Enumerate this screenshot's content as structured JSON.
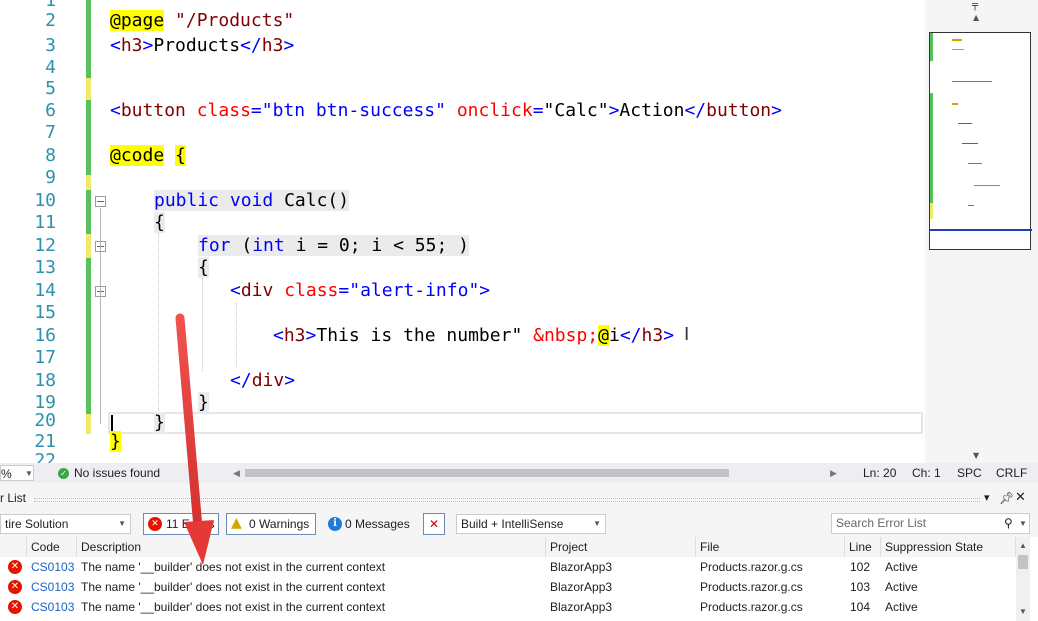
{
  "editor": {
    "lines": [
      {
        "num": "1"
      },
      {
        "num": "2"
      },
      {
        "num": "3"
      },
      {
        "num": "4"
      },
      {
        "num": "5"
      },
      {
        "num": "6"
      },
      {
        "num": "7"
      },
      {
        "num": "8"
      },
      {
        "num": "9"
      },
      {
        "num": "10"
      },
      {
        "num": "11"
      },
      {
        "num": "12"
      },
      {
        "num": "13"
      },
      {
        "num": "14"
      },
      {
        "num": "15"
      },
      {
        "num": "16"
      },
      {
        "num": "17"
      },
      {
        "num": "18"
      },
      {
        "num": "19"
      },
      {
        "num": "20"
      },
      {
        "num": "21"
      },
      {
        "num": "22"
      }
    ],
    "tokens": {
      "page_directive": "@page",
      "page_route": "\"/Products\"",
      "h3_open": "<h3>",
      "products_text": "Products",
      "h3_close": "</h3>",
      "button_open": "<button",
      "class_attr": "class=",
      "btn_classes": "\"btn btn-success\"",
      "onclick_attr": "onclick=",
      "onclick_val": "\"Calc\"",
      "gt": ">",
      "action_text": "Action",
      "button_close": "</button>",
      "lt": ">",
      "code_directive": "@code",
      "open_brace": "{",
      "close_brace": "}",
      "kw_public": "public",
      "kw_void": "void",
      "method_sig": "Calc()",
      "kw_for": "for",
      "paren_open": "(",
      "kw_int": "int",
      "for_rest": "i = 0; i < 55; )",
      "div_open": "<div",
      "div_class_val": "\"alert-info\"",
      "div_close": "</div>",
      "number_text": "This is the number\"",
      "nbsp": "&nbsp;",
      "at_sign": "@",
      "var_i": "i",
      "h3_close2": "</h3>"
    }
  },
  "status": {
    "zoom": "%",
    "issues": "No issues found",
    "line": "Ln: 20",
    "col": "Ch: 1",
    "spc": "SPC",
    "crlf": "CRLF"
  },
  "error_list": {
    "title": "r List",
    "scope": "tire Solution",
    "errors_btn": "11 Errors",
    "warnings_btn": "0 Warnings",
    "messages_btn": "0 Messages",
    "build_filter": "Build + IntelliSense",
    "search_placeholder": "Search Error List",
    "columns": [
      "Code",
      "Description",
      "Project",
      "File",
      "Line",
      "Suppression State"
    ],
    "rows": [
      {
        "code": "CS0103",
        "description": "The name '__builder' does not exist in the current context",
        "project": "BlazorApp3",
        "file": "Products.razor.g.cs",
        "line": "102",
        "state": "Active"
      },
      {
        "code": "CS0103",
        "description": "The name '__builder' does not exist in the current context",
        "project": "BlazorApp3",
        "file": "Products.razor.g.cs",
        "line": "103",
        "state": "Active"
      },
      {
        "code": "CS0103",
        "description": "The name '__builder' does not exist in the current context",
        "project": "BlazorApp3",
        "file": "Products.razor.g.cs",
        "line": "104",
        "state": "Active"
      }
    ]
  },
  "colors": {
    "arrow": "#e53935",
    "error": "#e51400",
    "line_number": "#2b91af"
  }
}
